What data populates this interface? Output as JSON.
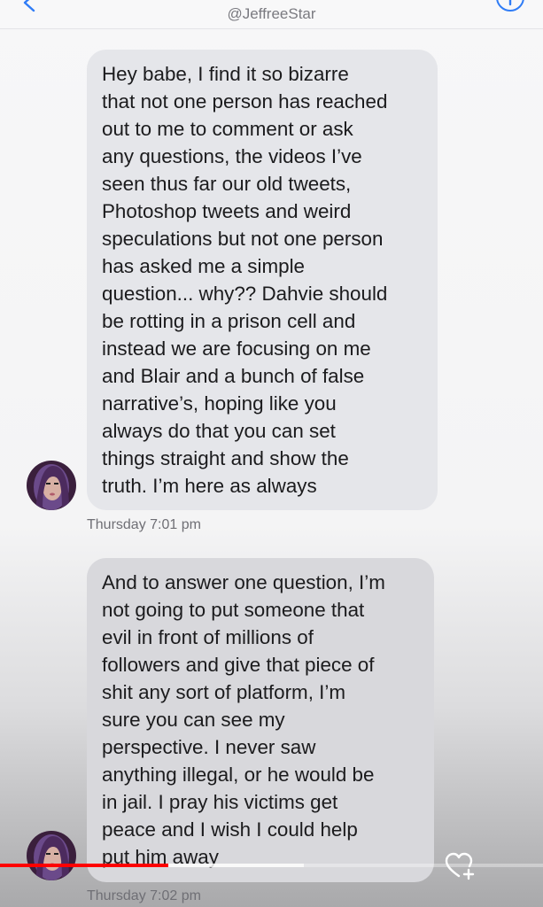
{
  "header": {
    "title": "@JeffreeStar",
    "back_icon": "chevron-left-icon",
    "info_icon": "info-icon",
    "accent_color": "#2f7cf6"
  },
  "messages": [
    {
      "text": "Hey babe, I find it so bizarre\nthat not one person has reached\nout to me to comment or ask\nany questions, the videos I’ve\nseen thus far our old tweets,\nPhotoshop tweets and weird\nspeculations but not one person\nhas asked me a simple\nquestion... why?? Dahvie should\nbe rotting in a prison cell and\ninstead we are focusing on me\nand Blair and a bunch of false\nnarrative’s, hoping like you\nalways do that you can set\nthings straight and show the\ntruth. I’m here as always",
      "timestamp": "Thursday 7:01 pm",
      "avatar_icon": "profile-avatar"
    },
    {
      "text": "And to answer one question, I’m\nnot going to put someone that\nevil in front of millions of\nfollowers and give that piece of\nshit any sort of platform, I’m\nsure you can see my\nperspective. I never saw\nanything illegal, or he would be\nin jail. I pray his victims get\npeace and I wish I could help\nput him away",
      "timestamp": "Thursday 7:02 pm",
      "avatar_icon": "profile-avatar"
    }
  ],
  "reaction": {
    "icon": "heart-plus-icon"
  },
  "video_progress": {
    "played_fraction": 0.31,
    "buffered_fraction": 0.56,
    "played_color": "#ff0000"
  }
}
